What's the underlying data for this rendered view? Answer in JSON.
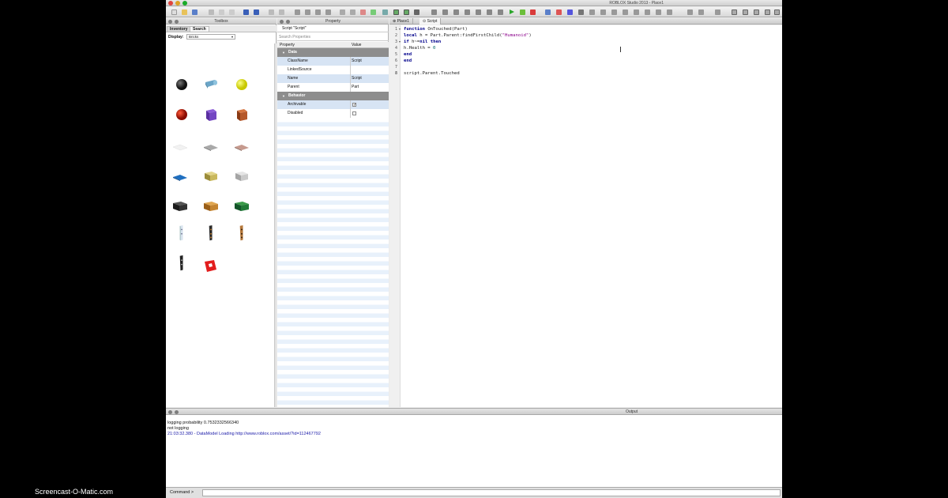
{
  "window": {
    "title": "ROBLOX Studio 2013 - Place1"
  },
  "toolbox": {
    "title": "Toolbox",
    "tabs": [
      "Inventory",
      "Search"
    ],
    "display_label": "Display:",
    "display_value": "Bricks"
  },
  "properties": {
    "title": "Property",
    "object_title": "Script \"Script\"",
    "search_placeholder": "Search Properties",
    "columns": [
      "Property",
      "Value"
    ],
    "sections": [
      {
        "name": "Data",
        "rows": [
          {
            "key": "ClassName",
            "value": "Script"
          },
          {
            "key": "LinkedSource",
            "value": ""
          },
          {
            "key": "Name",
            "value": "Script"
          },
          {
            "key": "Parent",
            "value": "Part"
          }
        ]
      },
      {
        "name": "Behavior",
        "rows": [
          {
            "key": "Archivable",
            "checked": true
          },
          {
            "key": "Disabled",
            "checked": false
          }
        ]
      }
    ]
  },
  "editor": {
    "tabs": [
      "Place1",
      "Script"
    ],
    "line_numbers": [
      "1",
      "2",
      "3",
      "4",
      "5",
      "6",
      "7",
      "8"
    ],
    "code_lines": [
      "function OnTouched(Part)",
      "local h = Part.Parent:findFirstChild(\"Humanoid\")",
      "if h~=nil then",
      "h.Health = 0",
      "end",
      "end",
      "",
      "script.Parent.Touched"
    ]
  },
  "output": {
    "title": "Output",
    "lines": [
      "logging probability 0.7532332566340",
      "not logging",
      "21:03:32.380 - DataModel Loading http://www.roblox.com/asset/?id=112467792"
    ]
  },
  "command": {
    "label": "Command >"
  },
  "watermark": "Screencast-O-Matic.com"
}
